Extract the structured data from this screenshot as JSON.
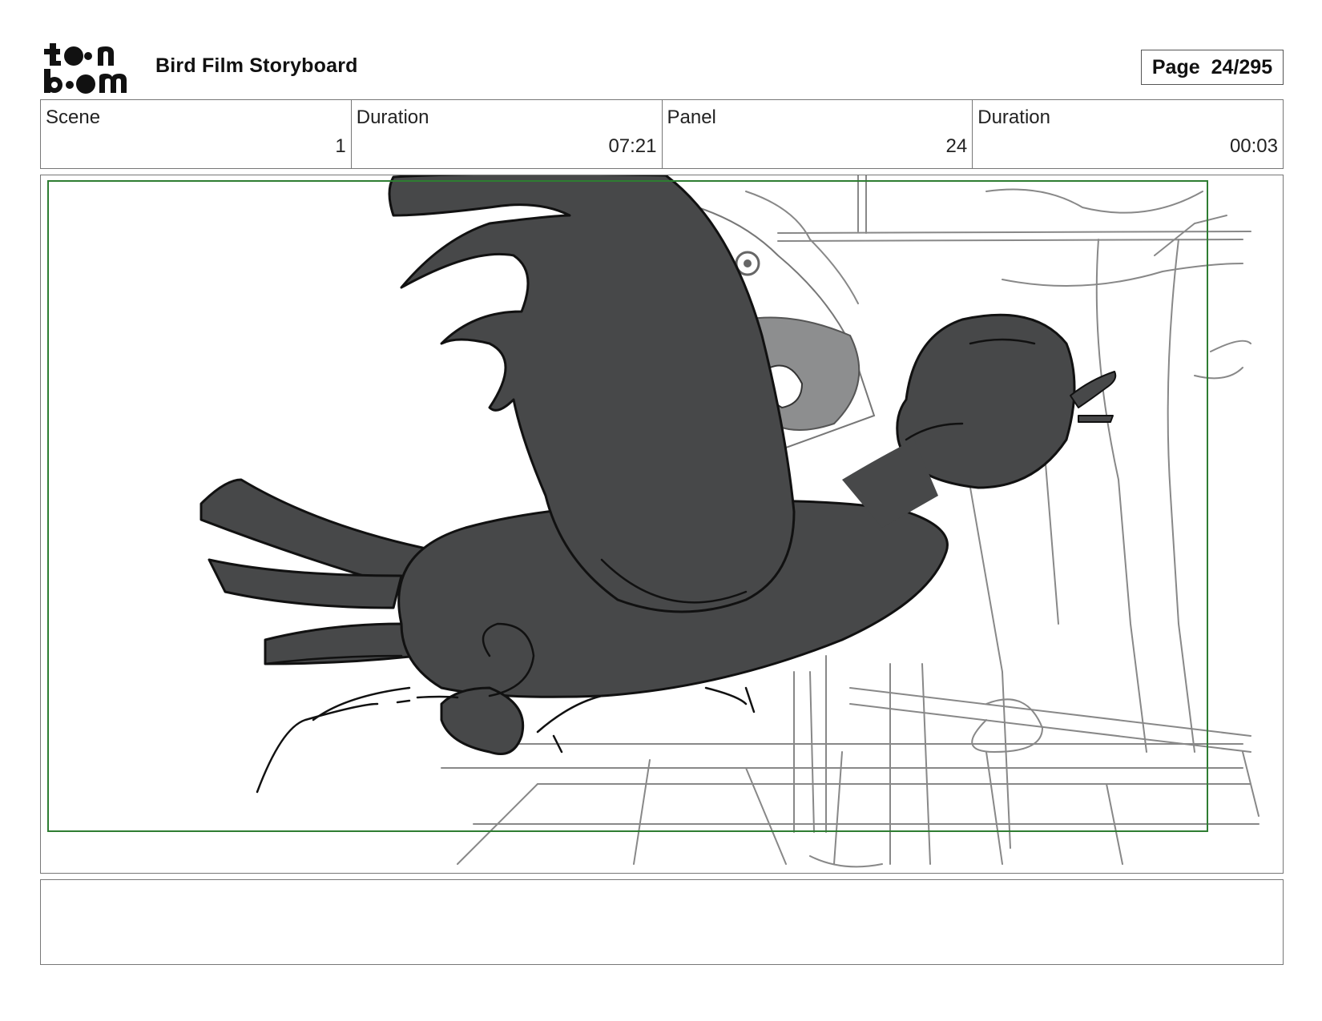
{
  "header": {
    "logo_text_top": "toon",
    "logo_text_bottom": "boom",
    "title": "Bird Film Storyboard",
    "page_label": "Page",
    "page_value": "24/295"
  },
  "info": [
    {
      "label": "Scene",
      "value": "1"
    },
    {
      "label": "Duration",
      "value": "07:21"
    },
    {
      "label": "Panel",
      "value": "24"
    },
    {
      "label": "Duration",
      "value": "00:03"
    }
  ],
  "panel": {
    "safe_frame_color": "#2e7d32",
    "bird_fill": "#474849",
    "sketch_color": "#777777"
  },
  "notes": ""
}
